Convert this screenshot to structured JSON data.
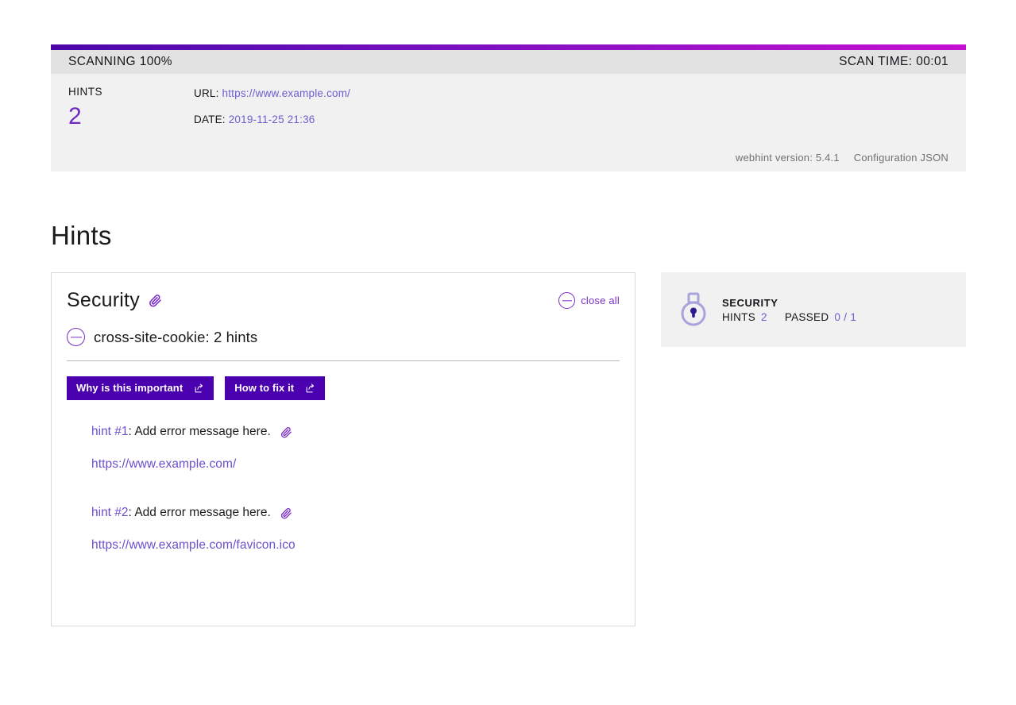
{
  "scan": {
    "status_label": "SCANNING 100%",
    "scan_time_label": "SCAN TIME: 00:01",
    "hints_label": "HINTS",
    "hints_count": "2",
    "url_key": "URL:",
    "url_value": "https://www.example.com/",
    "date_key": "DATE:",
    "date_value": "2019-11-25 21:36",
    "version_label": "webhint version: 5.4.1",
    "configuration_link": "Configuration JSON",
    "gradient_start": "#4b06a8",
    "gradient_end": "#c60fd2"
  },
  "page": {
    "title": "Hints"
  },
  "category_card": {
    "title": "Security",
    "clip_icon": "paperclip-icon",
    "close_all_label": "close all",
    "group": {
      "title": "cross-site-cookie: 2 hints",
      "collapse_icon": "minus-circle-icon"
    },
    "buttons": [
      {
        "label": "Why is this important",
        "icon": "external-link-icon"
      },
      {
        "label": "How to fix it",
        "icon": "external-link-icon"
      }
    ],
    "hints": [
      {
        "index": "hint #1",
        "separator": ": ",
        "message": "Add error message here.",
        "clip_icon": "paperclip-icon",
        "url": "https://www.example.com/"
      },
      {
        "index": "hint #2",
        "separator": ": ",
        "message": "Add error message here.",
        "clip_icon": "paperclip-icon",
        "url": "https://www.example.com/favicon.ico"
      }
    ]
  },
  "summary": {
    "icon": "padlock-icon",
    "name": "SECURITY",
    "hints_label": "HINTS",
    "hints_value": "2",
    "passed_label": "PASSED",
    "passed_value": "0 / 1"
  },
  "colors": {
    "accent_purple": "#7a2ec7",
    "button_purple": "#4b00b0",
    "link_purple": "#6b4fce",
    "panel_bg": "#f1f1f1",
    "panel_topbar_bg": "#e3e2e2"
  }
}
